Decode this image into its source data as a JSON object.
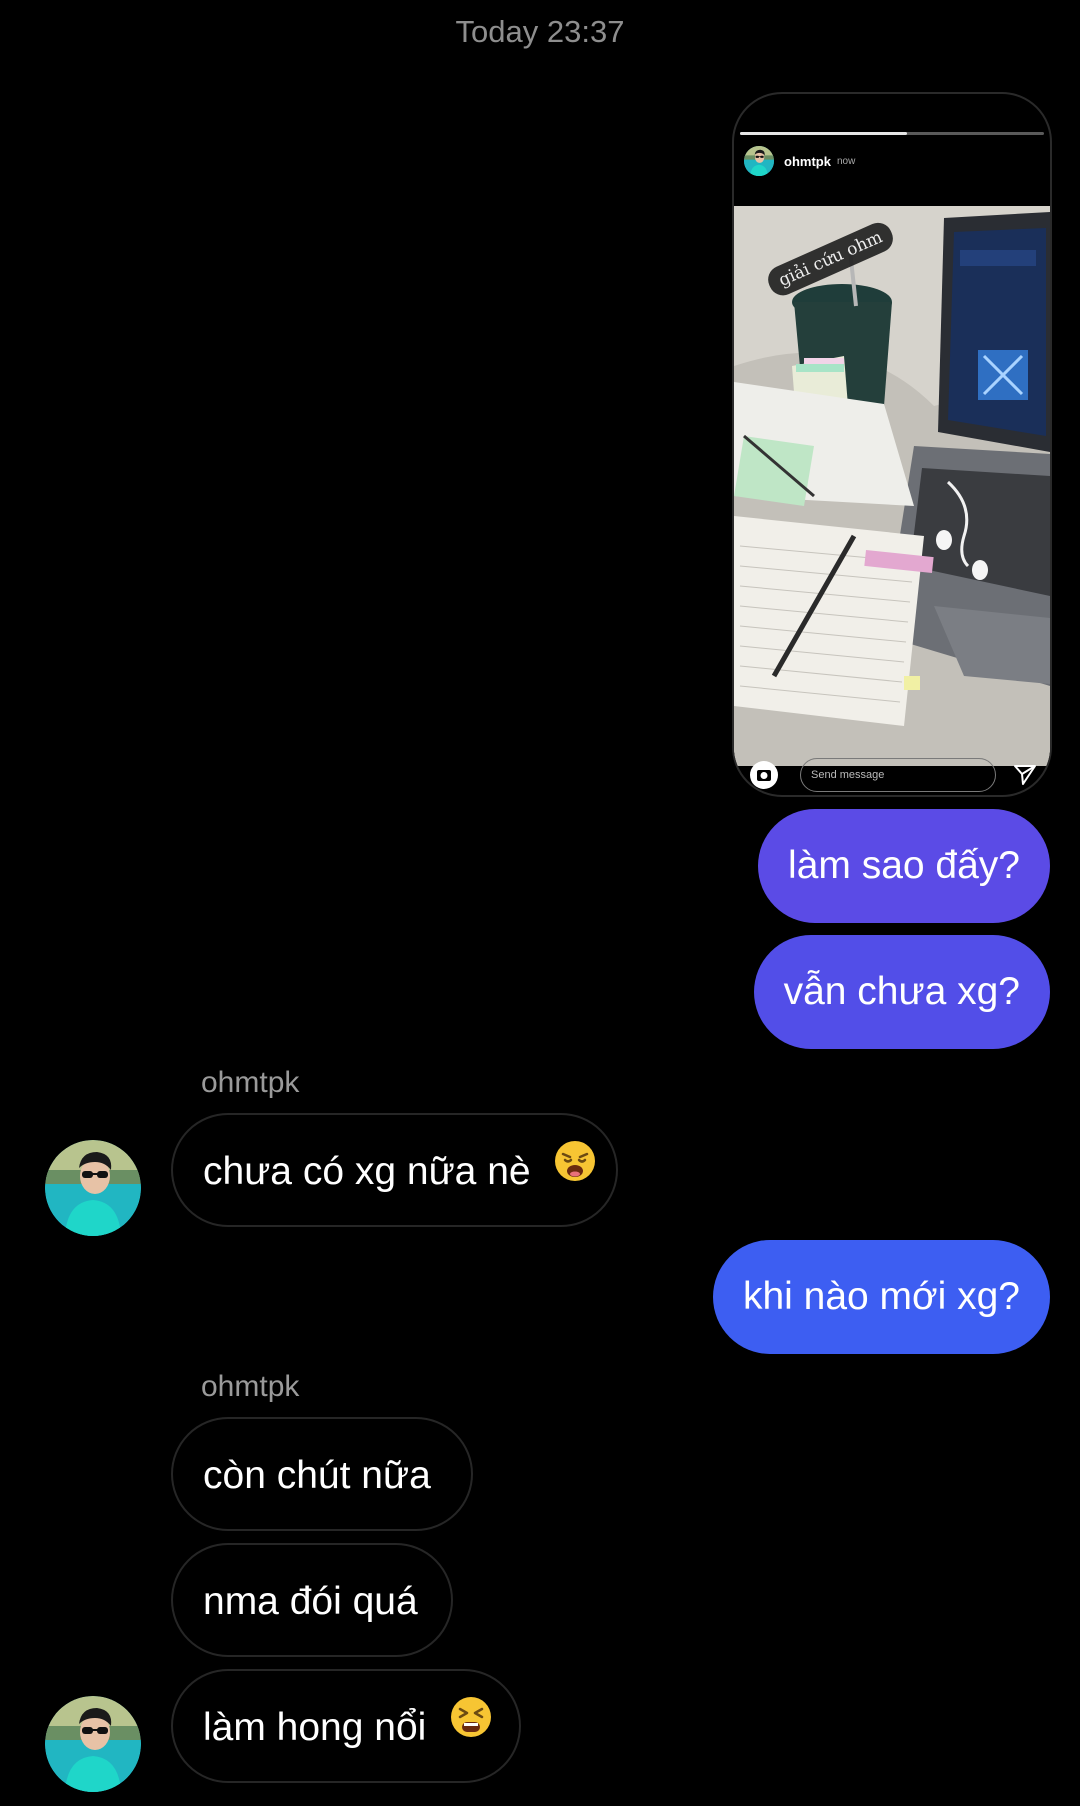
{
  "timestamp": "Today 23:37",
  "story": {
    "username": "ohmtpk",
    "time": "now",
    "sticker_text": "giải cứu ohm",
    "message_placeholder": "Send message",
    "progress": 0.55,
    "icons": [
      "camera-icon",
      "send-icon"
    ]
  },
  "messages": [
    {
      "direction": "out",
      "text": "làm sao đấy?",
      "color": "#5b4be6"
    },
    {
      "direction": "out",
      "text": "vẫn chưa xg?",
      "color": "#524ee8"
    },
    {
      "direction": "in",
      "sender": "ohmtpk",
      "text": "chưa có xg nữa nè",
      "emoji": "weary-face"
    },
    {
      "direction": "out",
      "text": "khi nào mới xg?",
      "color": "#3d5ef2"
    },
    {
      "direction": "in",
      "sender": "ohmtpk",
      "text": "còn chút nữa"
    },
    {
      "direction": "in",
      "text": "nma đói quá"
    },
    {
      "direction": "in",
      "text": "làm hong nổi",
      "emoji": "tired-face"
    }
  ]
}
